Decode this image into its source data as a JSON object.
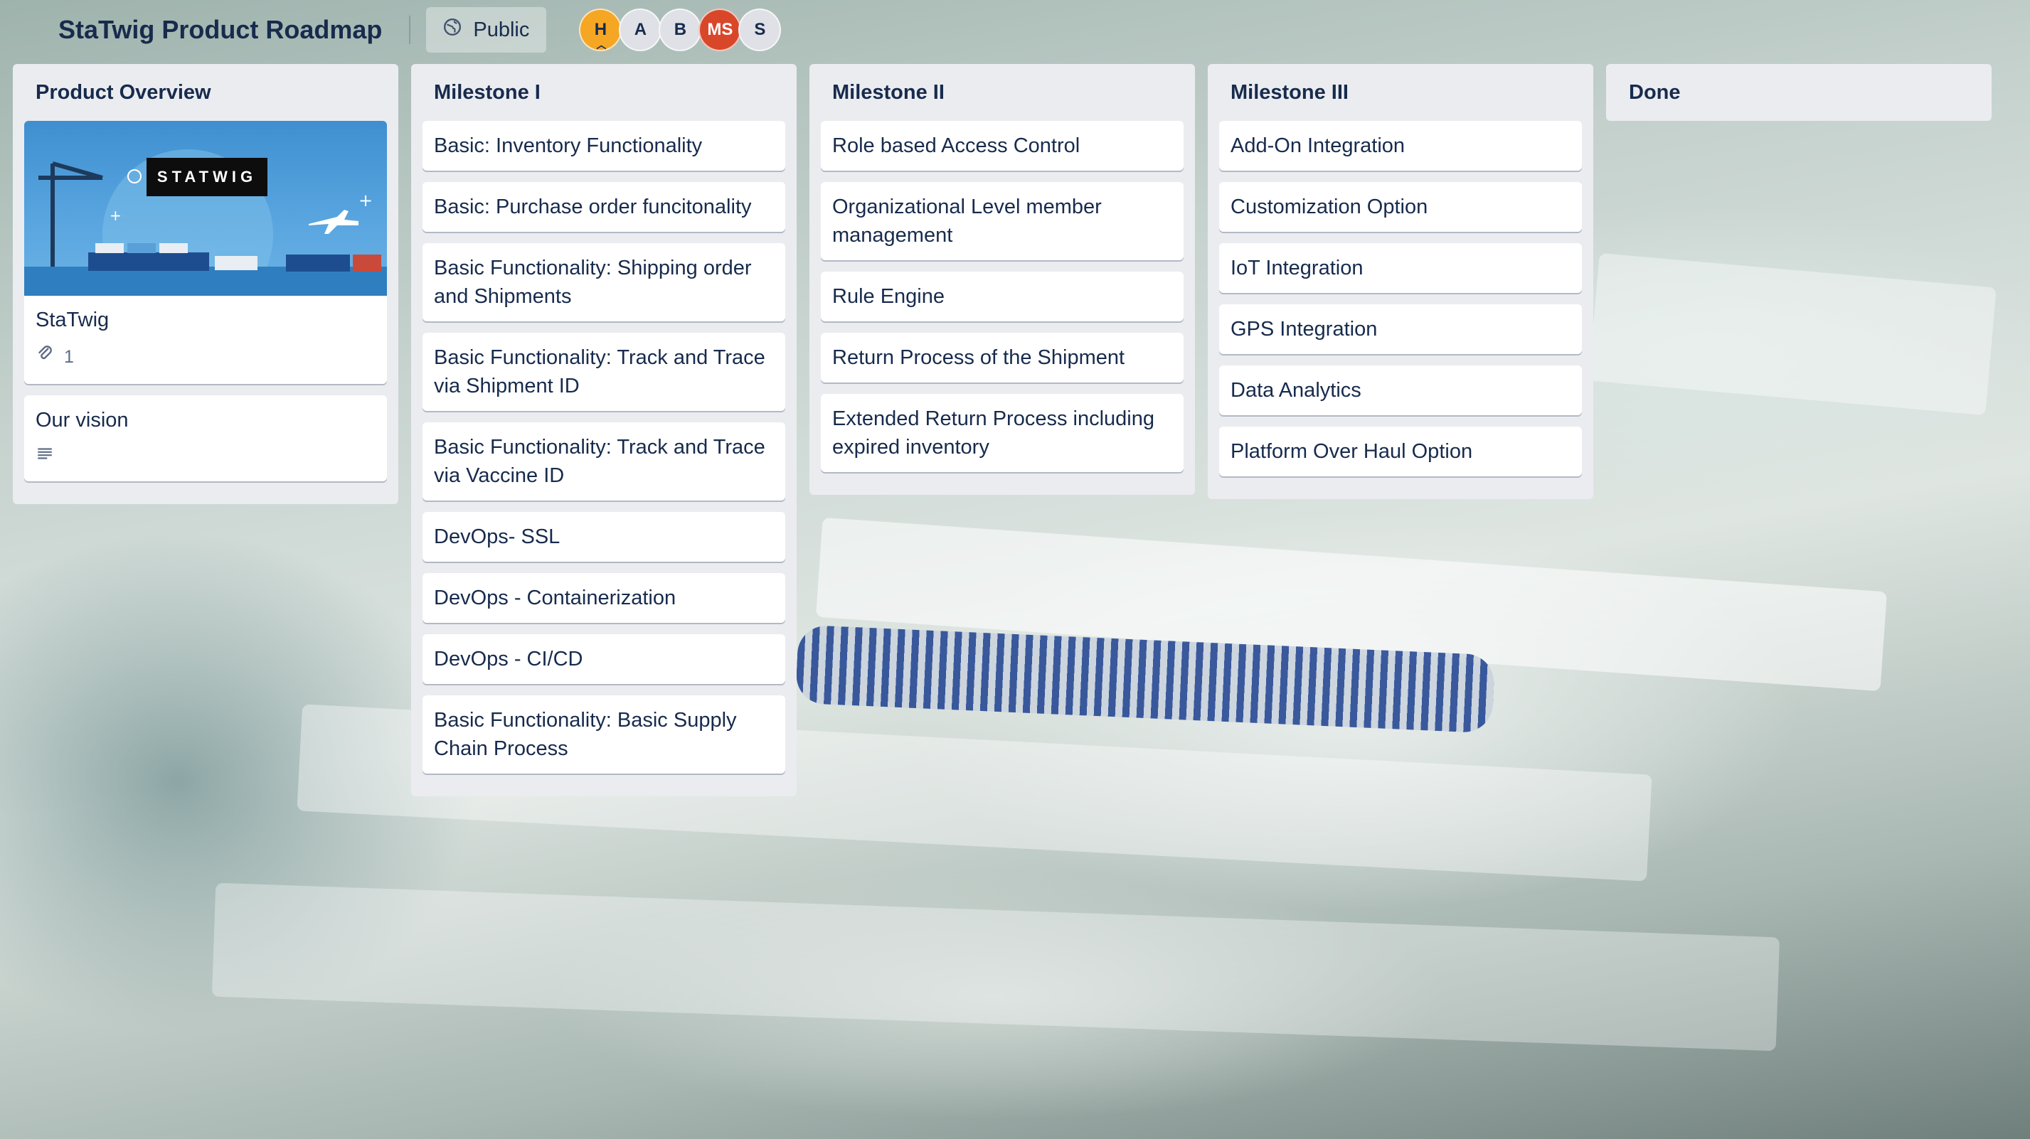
{
  "header": {
    "title": "StaTwig Product Roadmap",
    "visibility_label": "Public",
    "avatars": [
      {
        "initials": "H",
        "color": "#f5a623"
      },
      {
        "initials": "A",
        "color": "#dfe1e6"
      },
      {
        "initials": "B",
        "color": "#dfe1e6"
      },
      {
        "initials": "MS",
        "color": "#d9472b"
      },
      {
        "initials": "S",
        "color": "#dfe1e6"
      }
    ]
  },
  "lists": [
    {
      "title": "Product Overview",
      "cards": [
        {
          "title": "StaTwig",
          "attachments": "1",
          "cover_logo": "STATWIG"
        },
        {
          "title": "Our vision"
        }
      ]
    },
    {
      "title": "Milestone I",
      "cards": [
        "Basic: Inventory Functionality",
        "Basic: Purchase order funcitonality",
        "Basic Functionality: Shipping order and Shipments",
        "Basic Functionality: Track and Trace via Shipment ID",
        "Basic Functionality: Track and Trace via Vaccine ID",
        "DevOps- SSL",
        "DevOps - Containerization",
        "DevOps - CI/CD",
        "Basic Functionality: Basic Supply Chain Process"
      ]
    },
    {
      "title": "Milestone II",
      "cards": [
        "Role based Access Control",
        "Organizational Level member management",
        "Rule Engine",
        "Return Process of the Shipment",
        "Extended Return Process including expired inventory"
      ]
    },
    {
      "title": "Milestone III",
      "cards": [
        "Add-On Integration",
        "Customization Option",
        "IoT Integration",
        "GPS Integration",
        "Data Analytics",
        "Platform Over Haul Option"
      ]
    },
    {
      "title": "Done",
      "cards": []
    }
  ]
}
